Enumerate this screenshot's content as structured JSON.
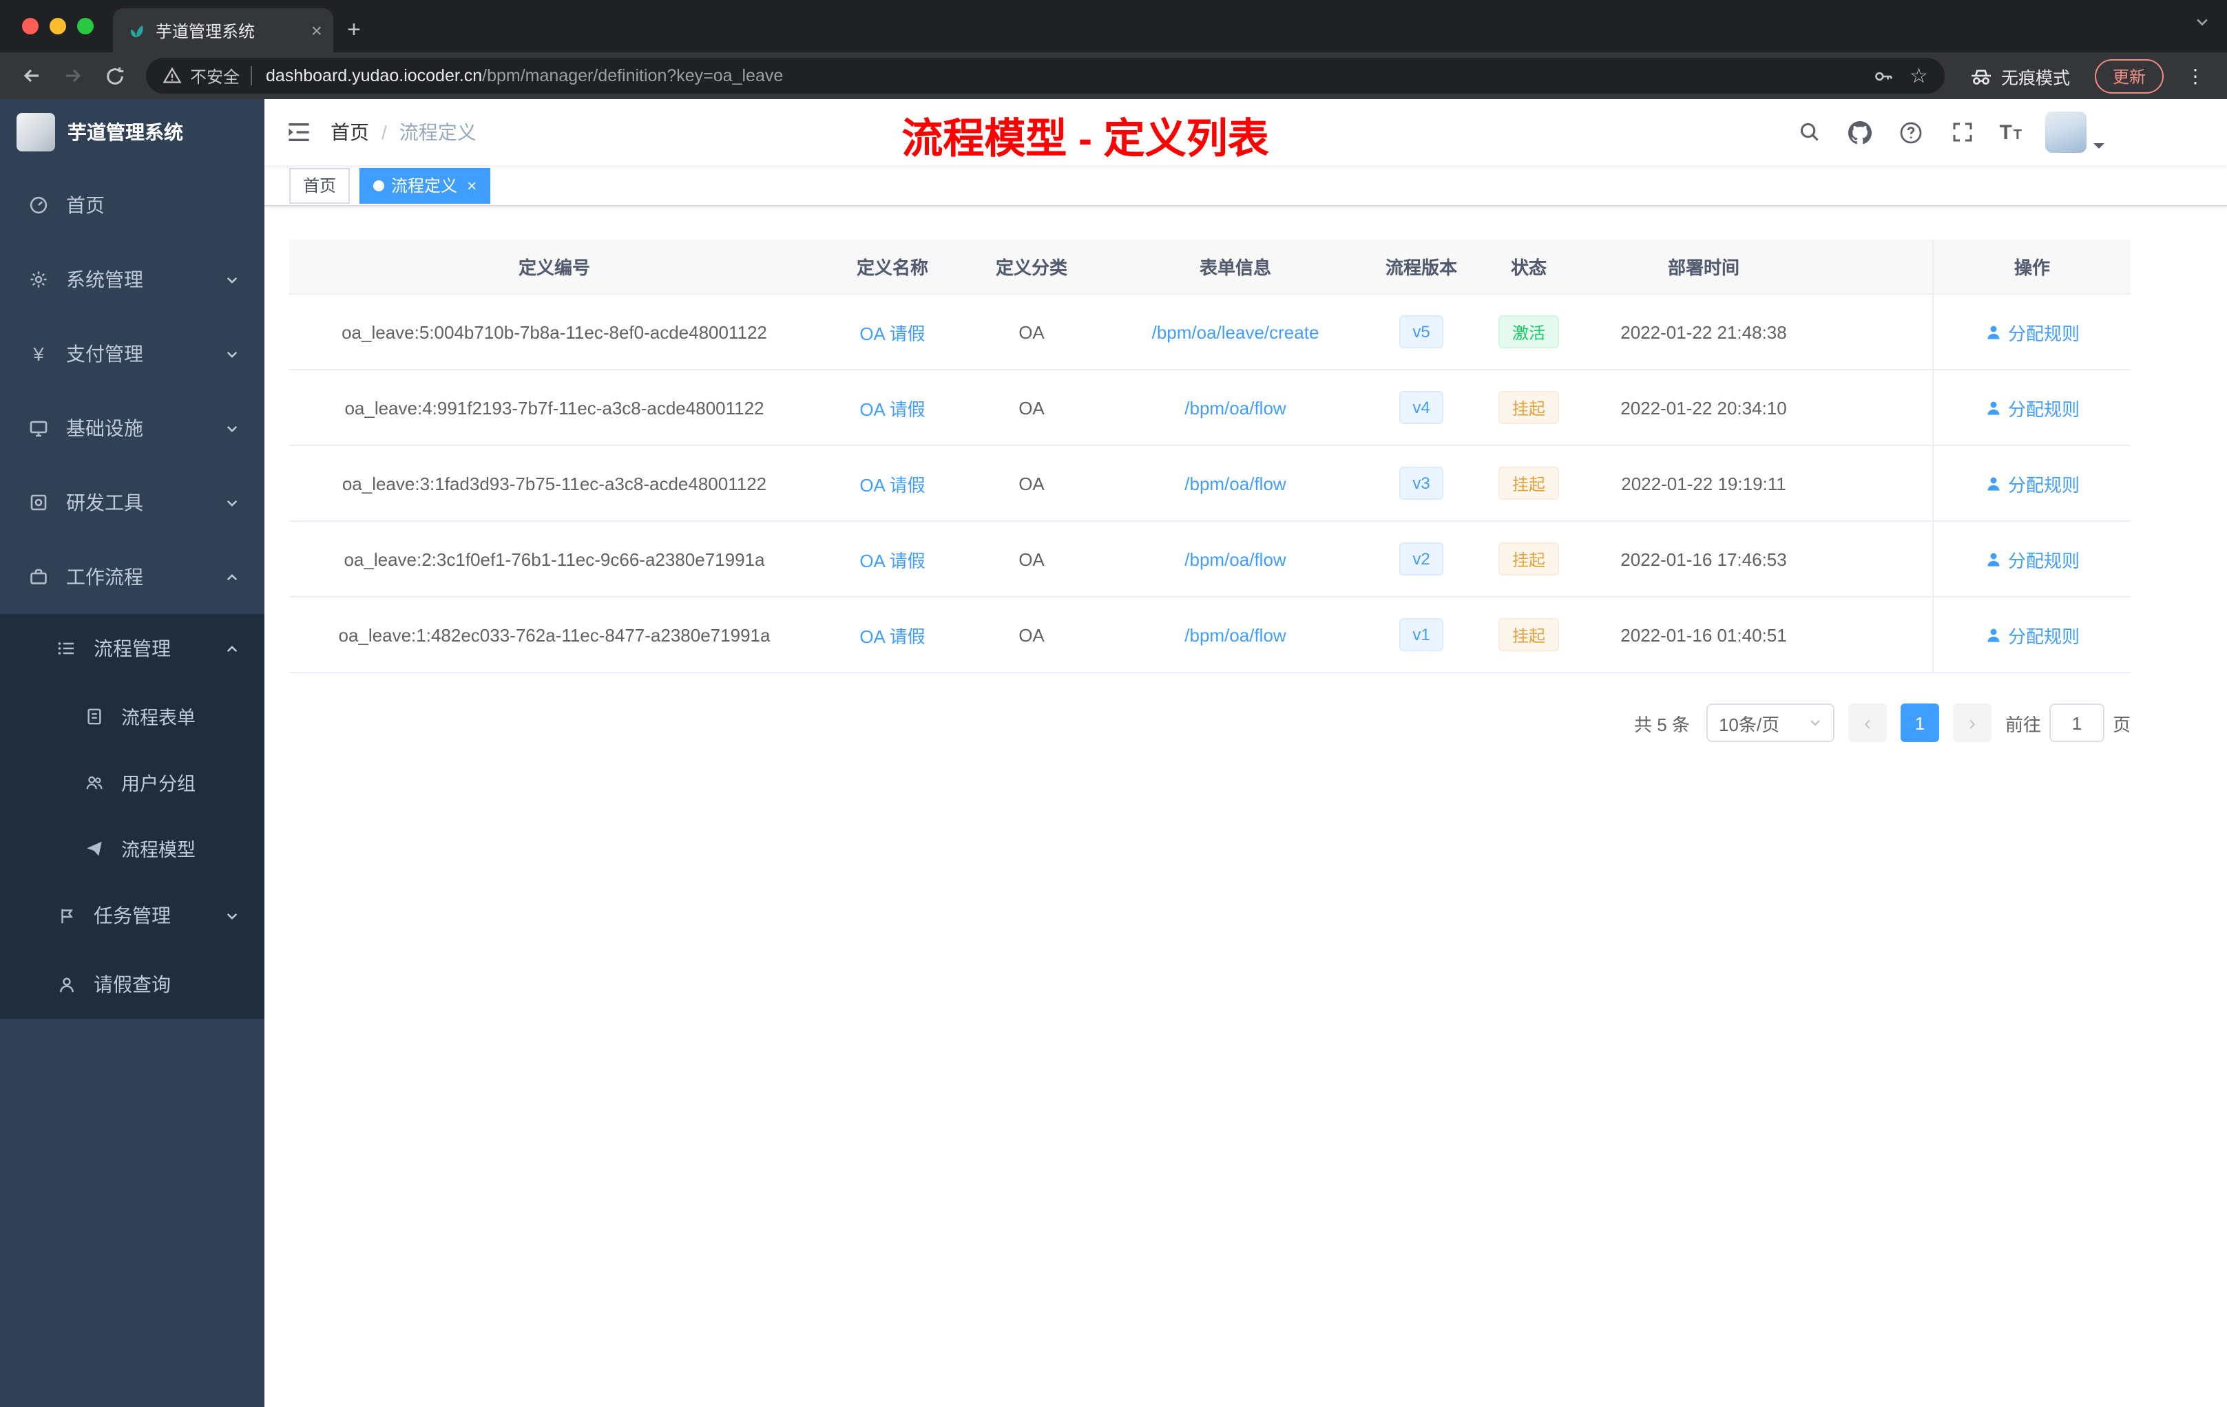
{
  "browser": {
    "tab_title": "芋道管理系统",
    "security_label": "不安全",
    "url_host": "dashboard.yudao.iocoder.cn",
    "url_path": "/bpm/manager/definition?key=oa_leave",
    "incognito_label": "无痕模式",
    "update_label": "更新"
  },
  "sidebar": {
    "logo_title": "芋道管理系统",
    "items": [
      {
        "label": "首页"
      },
      {
        "label": "系统管理"
      },
      {
        "label": "支付管理"
      },
      {
        "label": "基础设施"
      },
      {
        "label": "研发工具"
      },
      {
        "label": "工作流程"
      },
      {
        "label": "流程管理"
      },
      {
        "label": "流程表单"
      },
      {
        "label": "用户分组"
      },
      {
        "label": "流程模型"
      },
      {
        "label": "任务管理"
      },
      {
        "label": "请假查询"
      }
    ]
  },
  "navbar": {
    "breadcrumb": {
      "home": "首页",
      "current": "流程定义"
    },
    "annotation": "流程模型 - 定义列表"
  },
  "tags": {
    "home": "首页",
    "active": "流程定义",
    "close": "×"
  },
  "table": {
    "headers": [
      "定义编号",
      "定义名称",
      "定义分类",
      "表单信息",
      "流程版本",
      "状态",
      "部署时间",
      "操作"
    ],
    "rows": [
      {
        "id": "oa_leave:5:004b710b-7b8a-11ec-8ef0-acde48001122",
        "name": "OA 请假",
        "category": "OA",
        "form": "/bpm/oa/leave/create",
        "version": "v5",
        "status": "激活",
        "deploy_time": "2022-01-22 21:48:38",
        "action": "分配规则"
      },
      {
        "id": "oa_leave:4:991f2193-7b7f-11ec-a3c8-acde48001122",
        "name": "OA 请假",
        "category": "OA",
        "form": "/bpm/oa/flow",
        "version": "v4",
        "status": "挂起",
        "deploy_time": "2022-01-22 20:34:10",
        "action": "分配规则"
      },
      {
        "id": "oa_leave:3:1fad3d93-7b75-11ec-a3c8-acde48001122",
        "name": "OA 请假",
        "category": "OA",
        "form": "/bpm/oa/flow",
        "version": "v3",
        "status": "挂起",
        "deploy_time": "2022-01-22 19:19:11",
        "action": "分配规则"
      },
      {
        "id": "oa_leave:2:3c1f0ef1-76b1-11ec-9c66-a2380e71991a",
        "name": "OA 请假",
        "category": "OA",
        "form": "/bpm/oa/flow",
        "version": "v2",
        "status": "挂起",
        "deploy_time": "2022-01-16 17:46:53",
        "action": "分配规则"
      },
      {
        "id": "oa_leave:1:482ec033-762a-11ec-8477-a2380e71991a",
        "name": "OA 请假",
        "category": "OA",
        "form": "/bpm/oa/flow",
        "version": "v1",
        "status": "挂起",
        "deploy_time": "2022-01-16 01:40:51",
        "action": "分配规则"
      }
    ]
  },
  "pagination": {
    "total": "共 5 条",
    "page_size": "10条/页",
    "prev": "‹",
    "next": "›",
    "current_page": "1",
    "goto_label": "前往",
    "goto_value": "1",
    "page_unit": "页"
  },
  "colors": {
    "accent_blue": "#409eff",
    "success_green": "#13ce66",
    "warning_orange": "#e6a23c",
    "annotation_red": "#ff0000",
    "sidebar_bg": "#304156",
    "submenu_bg": "#1f2d3d"
  }
}
